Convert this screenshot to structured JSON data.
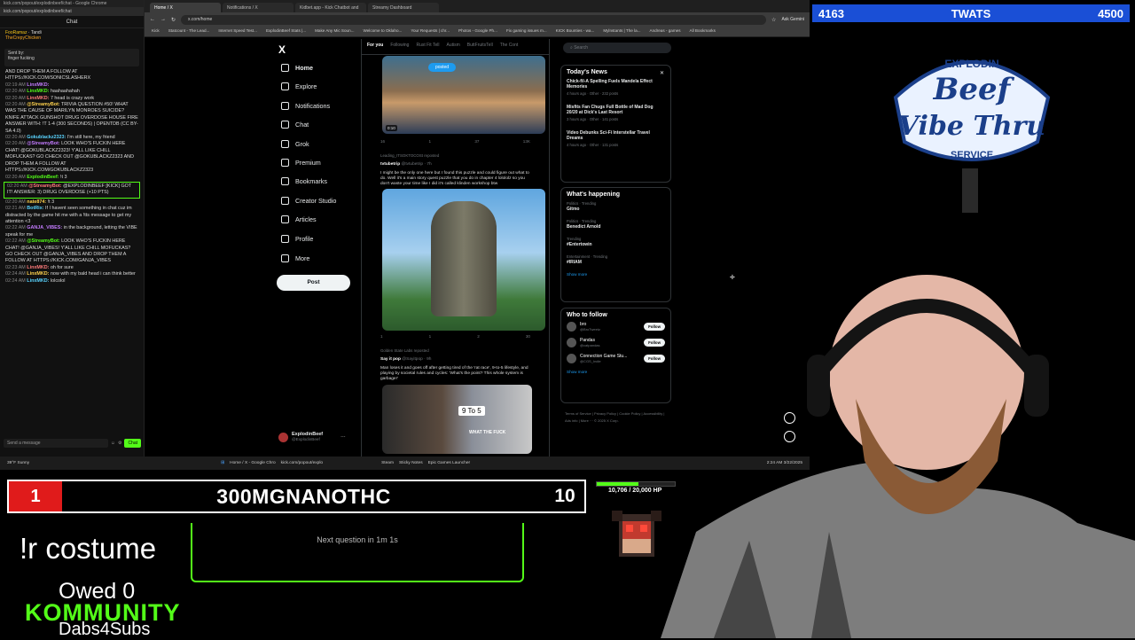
{
  "chat_panel": {
    "title_bar": "kick.com/popout/explodinbeef/chat - Google Chrome",
    "url": "kick.com/popout/explodinbeef/chat",
    "header": "Chat",
    "pinned_user1": "FooRamaz",
    "pinned_user2": "Tandi",
    "pinned_user3": "TheCrepyChicken",
    "sent_by": "Sent by:",
    "sent_text": "finger fucking",
    "messages": [
      {
        "time": "",
        "user": "",
        "text": "AND DROP THEM A FOLLOW AT HTTPS://KICK.COM/SONICSLASHERX"
      },
      {
        "time": "02:19 AM",
        "user": "LinxMKD:",
        "text": ""
      },
      {
        "time": "02:20 AM",
        "user": "LinxMKD:",
        "text": "haahaahahah"
      },
      {
        "time": "02:20 AM",
        "user": "LinxMKD:",
        "text": "7 head is crazy work"
      },
      {
        "time": "02:20 AM",
        "user": "@StreamyBot:",
        "text": "TRIVIA QUESTION #50! WHAT WAS THE CAUSE OF MARILYN MONROES SUICIDE? KNIFE ATTACK GUNSHOT DRUG OVERDOSE HOUSE FIRE ANSWER WITH: !T 1-4 (300 SECONDS) | OPENTDB (CC BY-SA 4.0)"
      },
      {
        "time": "02:20 AM",
        "user": "Gokublackz2323:",
        "text": "I'm still here, my friend"
      },
      {
        "time": "02:20 AM",
        "user": "@StreamyBot:",
        "text": "LOOK WHO'S FUCKIN HERE CHAT! @GOKUBLACKZ2323! Y'ALL LIKE CHILL MOFUCKAS? GO CHECK OUT @GOKUBLACKZ2323 AND DROP THEM A FOLLOW AT HTTPS://KICK.COM/GOKUBLACKZ2323"
      },
      {
        "time": "02:20 AM",
        "user": "ExplodinBeef:",
        "text": "!t 3"
      },
      {
        "time": "02:20 AM",
        "user": "@StreamyBot:",
        "text": "@EXPLODINBEEF [KICK] GOT IT! ANSWER: 3) DRUG OVERDOSE (+10 PTS)"
      },
      {
        "time": "02:20 AM",
        "user": "nate874:",
        "text": "!t 3"
      },
      {
        "time": "02:21 AM",
        "user": "BotRix:",
        "text": "If I havent seen something in chat cuz im distracted by the game hit me with a !tts message to get my attention <3"
      },
      {
        "time": "02:22 AM",
        "user": "GANJA_VIBES:",
        "text": "in the background, letting the VIBE speak for me"
      },
      {
        "time": "02:22 AM",
        "user": "@StreamyBot:",
        "text": "LOOK WHO'S FUCKIN HERE CHAT! @GANJA_VIBES! Y'ALL LIKE CHILL MOFUCKAS? GO CHECK OUT @GANJA_VIBES AND DROP THEM A FOLLOW AT HTTPS://KICK.COM/GANJA_VIBES"
      },
      {
        "time": "02:23 AM",
        "user": "LinxMKD:",
        "text": "oh for sure"
      },
      {
        "time": "02:24 AM",
        "user": "LinxMKD:",
        "text": "now with my bald head i can think better"
      },
      {
        "time": "02:24 AM",
        "user": "LinxMKD:",
        "text": "lolcolol"
      }
    ],
    "input_placeholder": "Send a message",
    "send_label": "Chat"
  },
  "browser": {
    "tabs": [
      "Home / X",
      "Notifications / X",
      "Kidbet.app - Kick Chatbot and",
      "Streamy Dashboard"
    ],
    "url": "x.com/home",
    "bookmarks": [
      "Kick",
      "Statcount - The Lead...",
      "Internet Speed Test...",
      "ExplodinBeef Stats |...",
      "Make Any Mic Soun...",
      "Welcome to Oklaho...",
      "Your Requests | chr...",
      "Photos - Google Ph...",
      "Fix gaming issues m...",
      "KICK Bounties - wa...",
      "Mylnstants | The la...",
      "Andreas - games",
      "All Bookmarks"
    ],
    "gemini": "Ask Gemini"
  },
  "x_nav": {
    "logo": "X",
    "items": [
      "Home",
      "Explore",
      "Notifications",
      "Chat",
      "Grok",
      "Premium",
      "Bookmarks",
      "Creator Studio",
      "Articles",
      "Profile",
      "More"
    ],
    "post": "Post",
    "profile_name": "ExplodinBeef",
    "profile_handle": "@ExplodinBeef"
  },
  "feed": {
    "tabs": [
      "For you",
      "Following",
      "Rust Fit Tell",
      "Autism",
      "ButtFruitsTell",
      "The Cont"
    ],
    "posted_badge": "posted",
    "video_time": "0:10",
    "tweet1_actions": [
      "16",
      "1",
      "37",
      "13K"
    ],
    "tweet2": {
      "repost": "Leading_ITSOKTOCOSt reposted",
      "name": "tvtubetrip",
      "handle": "@tvtubetrip · 7h",
      "text": "I might be the only one here but I found this puzzle and could figure out what to do. Well it's a main story quest puzzle that you do in chapter 4 lolololz so you don't waste your time like I did it's called klinden workshop btw",
      "actions": [
        "1",
        "1",
        "2",
        "30"
      ]
    },
    "tweet3": {
      "repost": "Golden State Labs reposted",
      "name": "Say it pop",
      "handle": "@Sayitpop · 9h",
      "text": "Man loses it and goes off after getting tired of the 'rat race', 9-to-5 lifestyle, and playing by societal rules and cycles: 'What's the point? This whole system is garbage!'",
      "caption_top": "9 To 5",
      "caption_bottom": "WHAT THE FUCK"
    }
  },
  "right_col": {
    "search_placeholder": "Search",
    "news_title": "Today's News",
    "news": [
      {
        "headline": "Chick-fil-A Spelling Fuels Mandela Effect Memories",
        "meta": "4 hours ago · Other · 232 posts"
      },
      {
        "headline": "Misfits Fan Chugs Full Bottle of Mad Dog 20/20 at Dick's Last Resort",
        "meta": "3 hours ago · Other · 141 posts"
      },
      {
        "headline": "Video Debunks Sci-Fi Interstellar Travel Dreams",
        "meta": "4 hours ago · Other · 131 posts"
      }
    ],
    "happening_title": "What's happening",
    "trends": [
      {
        "cat": "Politics · Trending",
        "name": "Gitmo"
      },
      {
        "cat": "Politics · Trending",
        "name": "Benedict Arnold"
      },
      {
        "cat": "Trending",
        "name": "#Entertowin"
      },
      {
        "cat": "Entertainment · Trending",
        "name": "#IRIAM"
      }
    ],
    "show_more": "Show more",
    "follow_title": "Who to follow",
    "follows": [
      {
        "name": "bro",
        "handle": "@BroTweetz"
      },
      {
        "name": "Pandas",
        "handle": "@catpandas"
      },
      {
        "name": "Connection Game Stu...",
        "handle": "@CGS_Indie"
      }
    ],
    "follow_label": "Follow",
    "footer": "Terms of Service | Privacy Policy | Cookie Policy | Accessibility | Ads info | More ··· © 2025 X Corp."
  },
  "taskbar": {
    "weather": "39°F Sunny",
    "apps": [
      "Home / X - Google Chro",
      "kick.com/popout/explo",
      "Steam",
      "Sticky Notes",
      "Epic Games Launcher"
    ],
    "clock": "2:24 AM 3/22/2025"
  },
  "overlay": {
    "top_left_num": "4163",
    "top_title": "TWATS",
    "top_right_num": "4500",
    "rank": "1",
    "leader": "300MGNANOTHC",
    "leader_score": "10",
    "costume": "!r costume",
    "next_question": "Next question in 1m 1s",
    "hp_text": "10,706 / 20,000 HP",
    "hp_fraction": 0.535,
    "owed": "Owed 0",
    "community": "KOMMUNITY",
    "dabs": "Dabs4Subs",
    "logo_top": "EXPLODIN",
    "logo_beef": "Beef",
    "logo_vibe": "Vibe Thru",
    "logo_service": "SERVICE",
    "accent": "#53fc18",
    "bar_blue": "#1a4fd6",
    "rank_red": "#e01b1b"
  }
}
